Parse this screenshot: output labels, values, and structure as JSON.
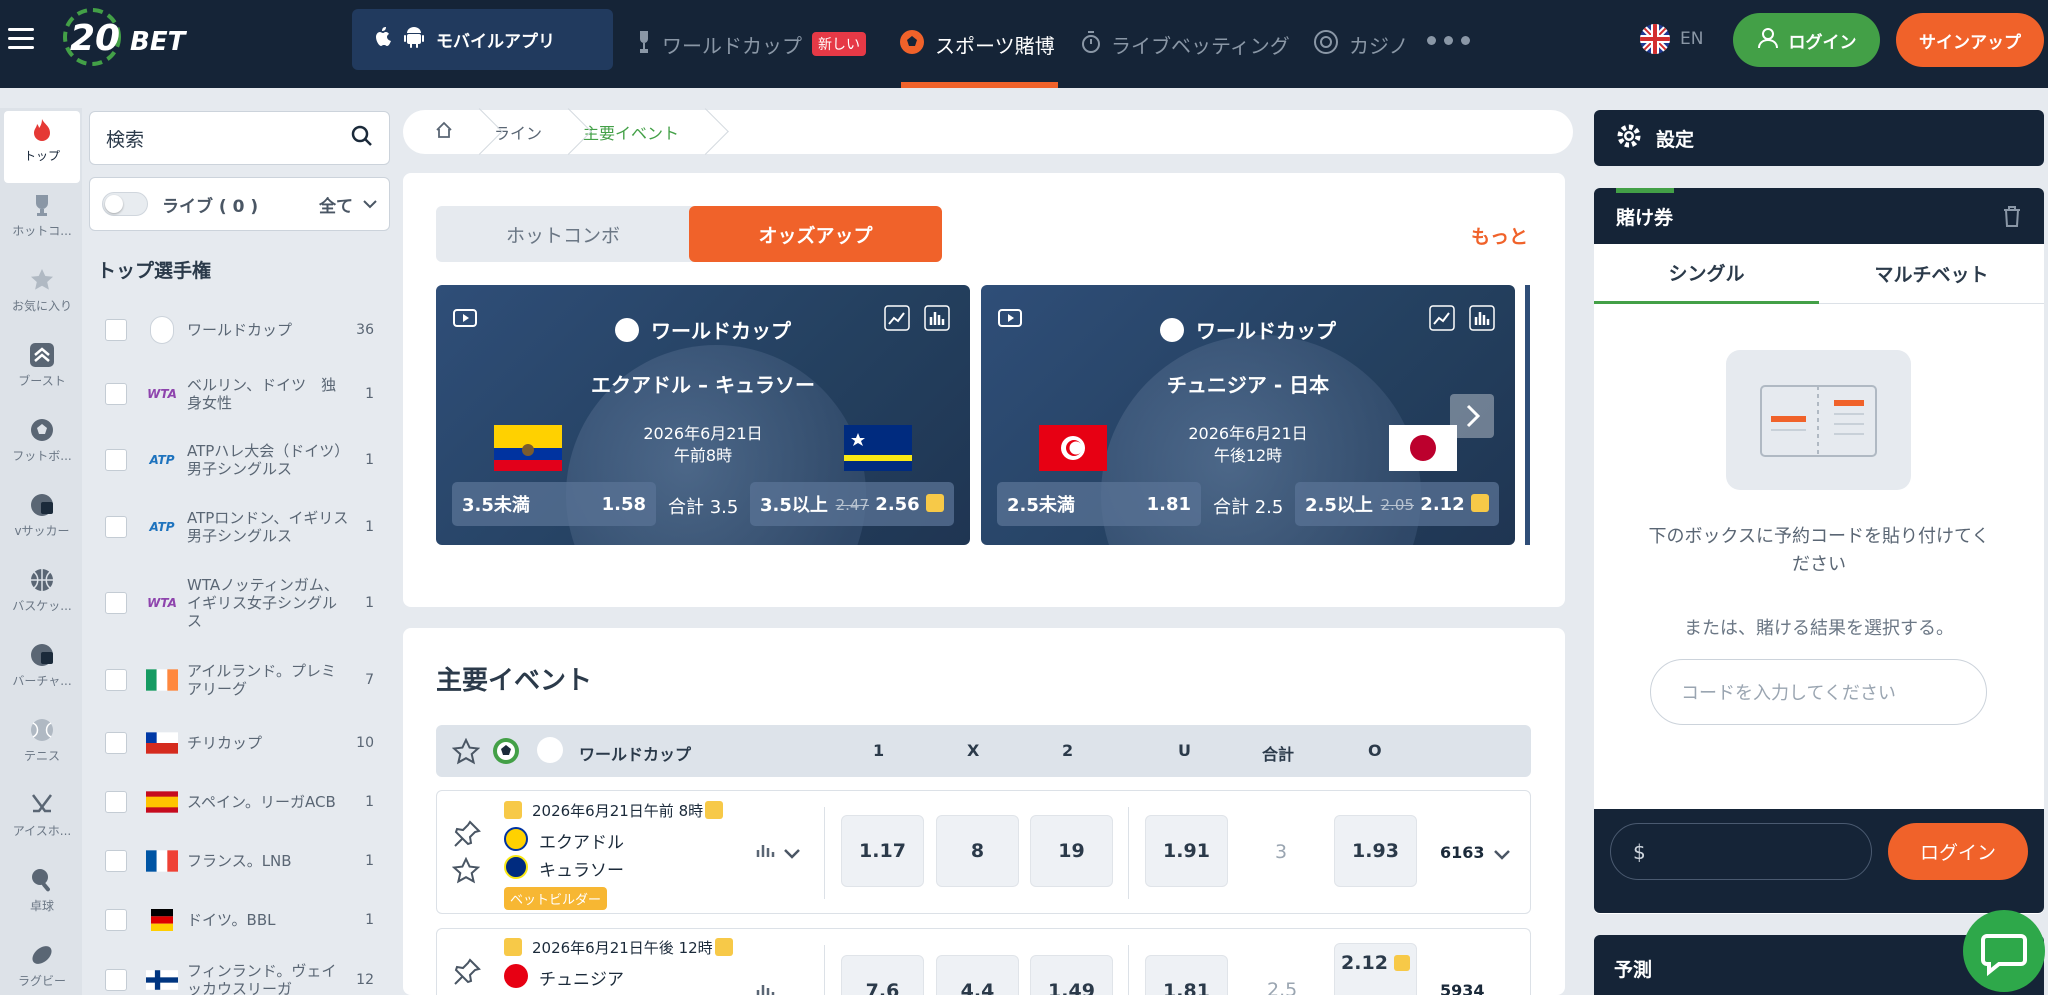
{
  "header": {
    "logo": "20BET",
    "mobile_app": "モバイルアプリ",
    "nav": [
      {
        "label": "ワールドカップ",
        "badge": "新しい"
      },
      {
        "label": "スポーツ賭博"
      },
      {
        "label": "ライブベッティング"
      },
      {
        "label": "カジノ"
      }
    ],
    "lang": "EN",
    "login": "ログイン",
    "signup": "サインアップ"
  },
  "rail": [
    "トップ",
    "ホットコ...",
    "お気に入り",
    "ブースト",
    "フットボ...",
    "vサッカー",
    "バスケッ...",
    "バーチャ...",
    "テニス",
    "アイスホ...",
    "卓球",
    "ラグビー"
  ],
  "left": {
    "search_placeholder": "検索",
    "live": "ライブ ( 0 )",
    "filter": "全て",
    "section_title": "トップ選手権",
    "items": [
      {
        "name": "ワールドカップ",
        "count": "36"
      },
      {
        "name": "ベルリン、ドイツ　独身女性",
        "count": "1"
      },
      {
        "name": "ATPハレ大会（ドイツ）男子シングルス",
        "count": "1"
      },
      {
        "name": "ATPロンドン、イギリス男子シングルス",
        "count": "1"
      },
      {
        "name": "WTAノッティンガム、イギリス女子シングルス",
        "count": "1"
      },
      {
        "name": "アイルランド。プレミアリーグ",
        "count": "7"
      },
      {
        "name": "チリカップ",
        "count": "10"
      },
      {
        "name": "スペイン。リーガACB",
        "count": "1"
      },
      {
        "name": "フランス。LNB",
        "count": "1"
      },
      {
        "name": "ドイツ。BBL",
        "count": "1"
      },
      {
        "name": "フィンランド。ヴェイッカウスリーガ",
        "count": "12"
      }
    ]
  },
  "breadcrumb": [
    "ライン",
    "主要イベント"
  ],
  "promo": {
    "tabs": [
      "ホットコンボ",
      "オッズアップ"
    ],
    "more": "もっと",
    "events": [
      {
        "league": "ワールドカップ",
        "teams": "エクアドル – キュラソー",
        "date": "2026年6月21日",
        "time": "午前8時",
        "under_label": "3.5未満",
        "under_odds": "1.58",
        "total": "合計 3.5",
        "over_label": "3.5以上",
        "over_old": "2.47",
        "over_odds": "2.56"
      },
      {
        "league": "ワールドカップ",
        "teams": "チュニジア - 日本",
        "date": "2026年6月21日",
        "time": "午後12時",
        "under_label": "2.5未満",
        "under_odds": "1.81",
        "total": "合計 2.5",
        "over_label": "2.5以上",
        "over_old": "2.05",
        "over_odds": "2.12"
      }
    ]
  },
  "main": {
    "title": "主要イベント",
    "league": "ワールドカップ",
    "cols": [
      "1",
      "X",
      "2",
      "U",
      "合計",
      "O"
    ],
    "rows": [
      {
        "date": "2026年6月21日午前 8時",
        "team1": "エクアドル",
        "team2": "キュラソー",
        "tag": "ベットビルダー",
        "o1": "1.17",
        "ox": "8",
        "o2": "19",
        "u": "1.91",
        "total": "3",
        "o": "1.93",
        "markets": "6163"
      },
      {
        "date": "2026年6月21日午後 12時",
        "team1": "チュニジア",
        "team2": "",
        "tag": "",
        "o1": "7.6",
        "ox": "4.4",
        "o2": "1.49",
        "u": "1.81",
        "total": "2.5",
        "o": "2.12",
        "markets": "5934"
      }
    ]
  },
  "right": {
    "settings": "設定",
    "betslip": "賭け券",
    "tabs": [
      "シングル",
      "マルチベット"
    ],
    "paste_text": "下のボックスに予約コードを貼り付けてください",
    "or_text": "または、賭ける結果を選択する。",
    "code_placeholder": "コードを入力してください",
    "currency": "$",
    "login": "ログイン",
    "predictions": "予測"
  },
  "colors": {
    "navy": "#152437",
    "accent": "#f0622a",
    "green": "#43a047"
  }
}
